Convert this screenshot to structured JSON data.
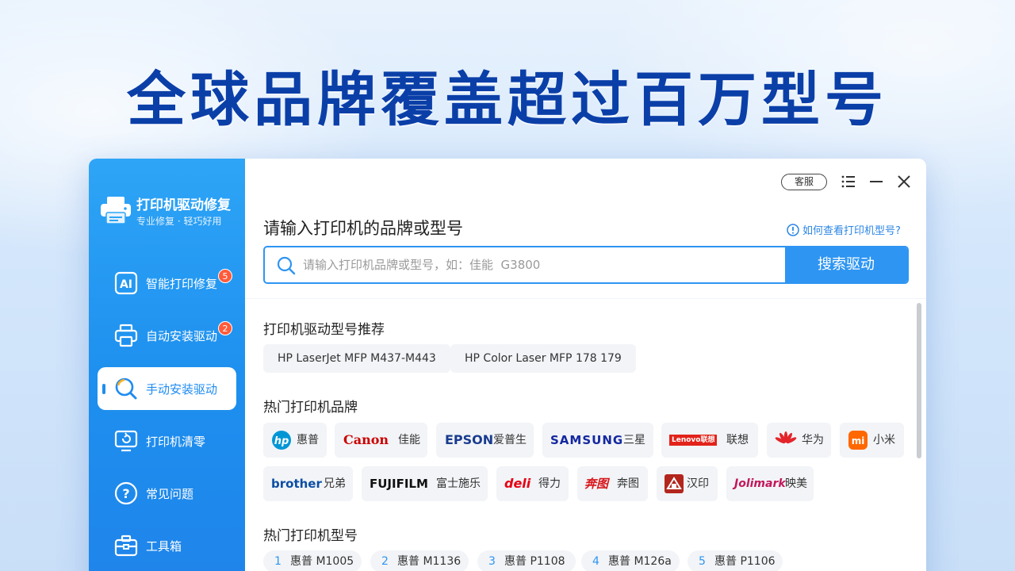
{
  "headline": "全球品牌覆盖超过百万型号",
  "app": {
    "title": "打印机驱动修复",
    "subtitle": "专业修复 · 轻巧好用"
  },
  "sidebar": {
    "items": [
      {
        "label": "智能打印修复",
        "icon": "ai-icon",
        "badge": "5"
      },
      {
        "label": "自动安装驱动",
        "icon": "printer-icon",
        "badge": "2"
      },
      {
        "label": "手动安装驱动",
        "icon": "search-icon",
        "active": true
      },
      {
        "label": "打印机清零",
        "icon": "reset-monitor-icon"
      },
      {
        "label": "常见问题",
        "icon": "question-icon"
      },
      {
        "label": "工具箱",
        "icon": "toolbox-icon"
      }
    ]
  },
  "window": {
    "kefu_label": "客服"
  },
  "search": {
    "title": "请输入打印机的品牌或型号",
    "help_link": "如何查看打印机型号?",
    "placeholder": "请输入打印机品牌或型号，如：佳能  G3800",
    "button": "搜索驱动"
  },
  "recommend": {
    "title": "打印机驱动型号推荐",
    "items": [
      "HP LaserJet MFP M437-M443",
      "HP Color Laser MFP 178 179"
    ]
  },
  "brands": {
    "title": "热门打印机品牌",
    "items": [
      {
        "logo": "hp",
        "name": "惠普",
        "color": "#0096d6"
      },
      {
        "logo": "Canon",
        "name": "佳能",
        "color": "#cc0000"
      },
      {
        "logo": "EPSON",
        "name": "爱普生",
        "color": "#1a3c8f"
      },
      {
        "logo": "SAMSUNG",
        "name": "三星",
        "color": "#1428a0"
      },
      {
        "logo": "Lenovo联想",
        "name": "联想",
        "color": "#e2231a"
      },
      {
        "logo": "HUAWEI",
        "name": "华为",
        "color": "#e3252b"
      },
      {
        "logo": "mi",
        "name": "小米",
        "color": "#ff6700"
      },
      {
        "logo": "brother",
        "name": "兄弟",
        "color": "#0d4ea3"
      },
      {
        "logo": "FUJIFILM",
        "name": "富士施乐",
        "color": "#111111"
      },
      {
        "logo": "deli",
        "name": "得力",
        "color": "#e60012"
      },
      {
        "logo": "奔图",
        "name": "奔图",
        "color": "#d7161b"
      },
      {
        "logo": "汉印",
        "name": "汉印",
        "color": "#b3261e"
      },
      {
        "logo": "Jolimark",
        "name": "映美",
        "color": "#c2185b"
      }
    ]
  },
  "models": {
    "title": "热门打印机型号",
    "items": [
      {
        "num": "1",
        "name": "惠普 M1005"
      },
      {
        "num": "2",
        "name": "惠普 M1136"
      },
      {
        "num": "3",
        "name": "惠普 P1108"
      },
      {
        "num": "4",
        "name": "惠普 M126a"
      },
      {
        "num": "5",
        "name": "惠普 P1106"
      }
    ]
  },
  "colors": {
    "headline": "#0b3fa8",
    "accent": "#2e95f2",
    "sidebar": "#1e90ef",
    "badge": "#ff5b3a"
  }
}
